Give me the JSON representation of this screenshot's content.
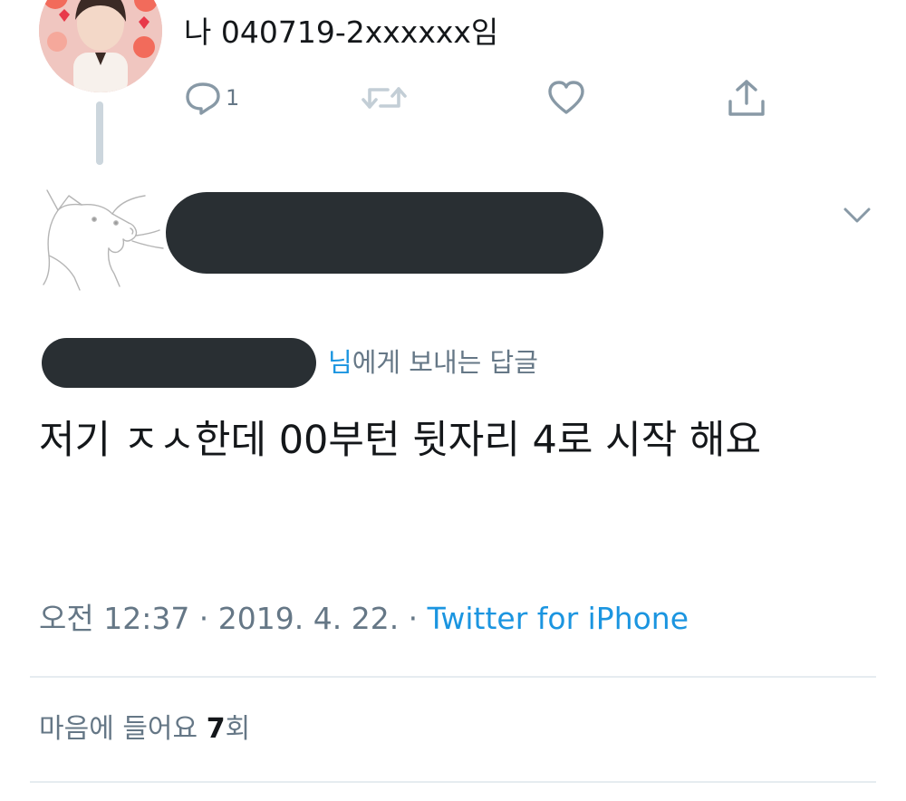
{
  "parent_tweet": {
    "text_cut_off": "",
    "text": "나 040719-2xxxxxx임",
    "actions": {
      "reply_count": "1",
      "reply_icon": "speech-bubble-icon",
      "retweet_icon": "retweet-icon",
      "like_icon": "heart-icon",
      "share_icon": "share-icon"
    }
  },
  "reply_tweet": {
    "reply_to_mention": "님",
    "reply_to_suffix": "에게 보내는 답글",
    "text": "저기 ㅈㅅ한데 00부턴 뒷자리 4로 시작 해요",
    "timestamp": "오전 12:37 · 2019. 4. 22. · ",
    "source": "Twitter for iPhone",
    "likes_label": "마음에 들어요 ",
    "likes_count": "7",
    "likes_suffix": "회",
    "menu_icon": "chevron-down-icon"
  },
  "colors": {
    "link_blue": "#1b95e0",
    "secondary_text": "#657786",
    "icon_gray": "#8899a6",
    "redaction": "#292f33",
    "divider": "#e6ecf0",
    "thread_line": "#ccd6dd"
  }
}
